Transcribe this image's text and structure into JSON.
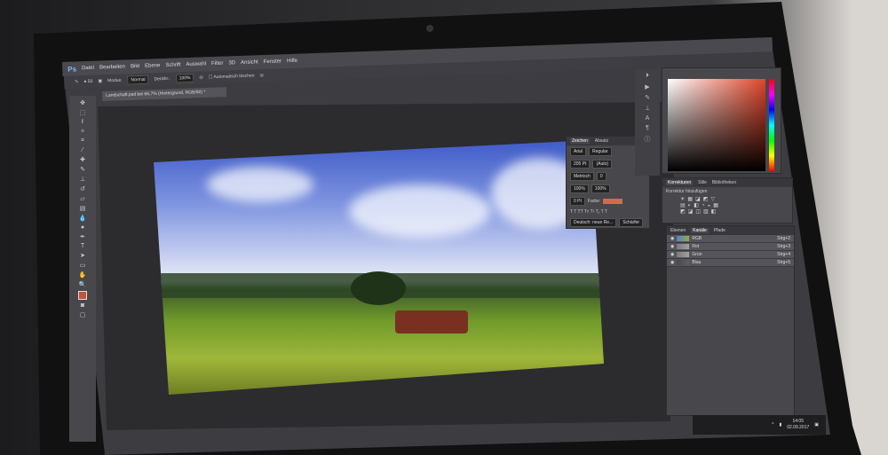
{
  "app": {
    "logo": "Ps",
    "menu": [
      "Datei",
      "Bearbeiten",
      "Bild",
      "Ebene",
      "Schrift",
      "Auswahl",
      "Filter",
      "3D",
      "Ansicht",
      "Fenster",
      "Hilfe"
    ]
  },
  "options": {
    "brush_size": "50",
    "mode_label": "Modus:",
    "mode_value": "Normal",
    "opacity_label": "Deckkr.:",
    "opacity_value": "100%",
    "auto_erase": "Automatisch löschen"
  },
  "document": {
    "tab": "Landschaft.psd bei 66,7% (Hintergrund, RGB/8#) *"
  },
  "character": {
    "tabs": [
      "Zeichen",
      "Absatz"
    ],
    "font": "Arial",
    "style": "Regular",
    "size": "205 Pt",
    "leading": "(Auto)",
    "kerning": "Metrisch",
    "tracking": "0",
    "vscale": "100%",
    "hscale": "100%",
    "baseline": "0 Pt",
    "color_label": "Farbe:",
    "language": "Deutsch: neue Re...",
    "aa": "Schärfer",
    "color": "#d26a4f"
  },
  "adjustments": {
    "tabs": [
      "Korrekturen",
      "Stile",
      "Bibliotheken"
    ],
    "heading": "Korrektur hinzufügen"
  },
  "layers": {
    "tabs": [
      "Ebenen",
      "Kanäle",
      "Pfade"
    ],
    "rows": [
      {
        "name": "RGB",
        "key": "Strg+2"
      },
      {
        "name": "Rot",
        "key": "Strg+3"
      },
      {
        "name": "Grün",
        "key": "Strg+4"
      },
      {
        "name": "Blau",
        "key": "Strg+5"
      }
    ]
  },
  "taskbar": {
    "time": "14:05",
    "date": "02.09.2017"
  }
}
